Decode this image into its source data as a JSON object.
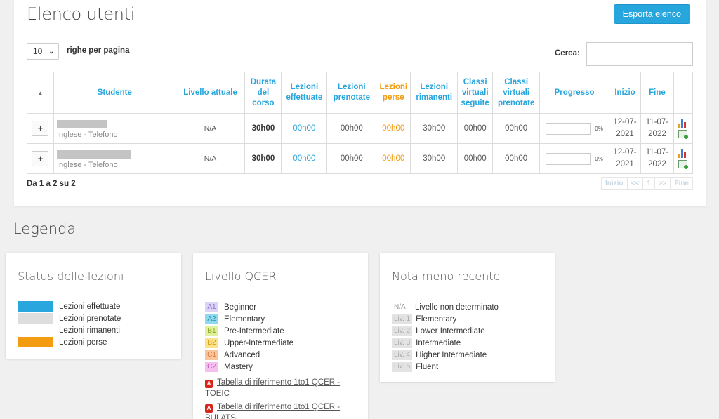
{
  "header": {
    "title": "Elenco utenti",
    "export_label": "Esporta elenco"
  },
  "controls": {
    "page_size": "10",
    "page_size_label": "righe per pagina",
    "search_label": "Cerca:",
    "search_value": ""
  },
  "table": {
    "columns": {
      "studente": "Studente",
      "livello": "Livello attuale",
      "durata": "Durata del corso",
      "effettuate": "Lezioni effettuate",
      "prenotate": "Lezioni prenotate",
      "perse": "Lezioni perse",
      "rimanenti": "Lezioni rimanenti",
      "cv_seguite": "Classi virtuali seguite",
      "cv_prenotate": "Classi virtuali prenotate",
      "progresso": "Progresso",
      "inizio": "Inizio",
      "fine": "Fine"
    },
    "rows": [
      {
        "expand": "+",
        "course": "Inglese - Telefono",
        "level": "N/A",
        "duration": "30h00",
        "done": "00h00",
        "booked": "00h00",
        "lost": "00h00",
        "remaining": "30h00",
        "vc_done": "00h00",
        "vc_booked": "00h00",
        "progress_pct": "0%",
        "progress_value": 0,
        "start": "12-07-2021",
        "end": "11-07-2022"
      },
      {
        "expand": "+",
        "course": "Inglese - Telefono",
        "level": "N/A",
        "duration": "30h00",
        "done": "00h00",
        "booked": "00h00",
        "lost": "00h00",
        "remaining": "30h00",
        "vc_done": "00h00",
        "vc_booked": "00h00",
        "progress_pct": "0%",
        "progress_value": 0,
        "start": "12-07-2021",
        "end": "11-07-2022"
      }
    ],
    "info": "Da 1 a 2 su 2",
    "pager": {
      "first": "Inizio",
      "prev": "<<",
      "page": "1",
      "next": ">>",
      "last": "Fine"
    }
  },
  "legend": {
    "title": "Legenda",
    "status": {
      "title": "Status delle lezioni",
      "items": [
        {
          "label": "Lezioni effettuate",
          "color": "#2aa6df"
        },
        {
          "label": "Lezioni prenotate",
          "color": "#dedede"
        },
        {
          "label": "Lezioni rimanenti",
          "color": "#ffffff"
        },
        {
          "label": "Lezioni perse",
          "color": "#f39c12"
        }
      ]
    },
    "qcer": {
      "title": "Livello QCER",
      "items": [
        {
          "code": "A1",
          "label": "Beginner",
          "bg": "#dcd3f5",
          "fg": "#8a6fd1"
        },
        {
          "code": "A2",
          "label": "Elementary",
          "bg": "#8fd9ee",
          "fg": "#2a8fb0"
        },
        {
          "code": "B1",
          "label": "Pre-Intermediate",
          "bg": "#dff19a",
          "fg": "#8aa01f"
        },
        {
          "code": "B2",
          "label": "Upper-Intermediate",
          "bg": "#fde28a",
          "fg": "#c89a12"
        },
        {
          "code": "C1",
          "label": "Advanced",
          "bg": "#fbc59c",
          "fg": "#d9793a"
        },
        {
          "code": "C2",
          "label": "Mastery",
          "bg": "#f5c0f0",
          "fg": "#c457b6"
        }
      ],
      "refs": [
        {
          "label": "Tabella di riferimento 1to1 QCER - TOEIC"
        },
        {
          "label": "Tabella di riferimento 1to1 QCER - BULATS"
        }
      ]
    },
    "nota": {
      "title": "Nota meno recente",
      "items": [
        {
          "code": "N/A",
          "label": "Livello non determinato",
          "grey": false
        },
        {
          "code": "Liv. 1",
          "label": "Elementary",
          "grey": true
        },
        {
          "code": "Liv. 2",
          "label": "Lower Intermediate",
          "grey": true
        },
        {
          "code": "Liv. 3",
          "label": "Intermediate",
          "grey": true
        },
        {
          "code": "Liv. 4",
          "label": "Higher Intermediate",
          "grey": true
        },
        {
          "code": "Liv. 5",
          "label": "Fluent",
          "grey": true
        }
      ]
    }
  },
  "icons": {
    "sort": "sort-arrow-icon",
    "stats": "bar-chart-icon",
    "calendar": "calendar-check-icon",
    "pdf": "pdf-icon"
  }
}
